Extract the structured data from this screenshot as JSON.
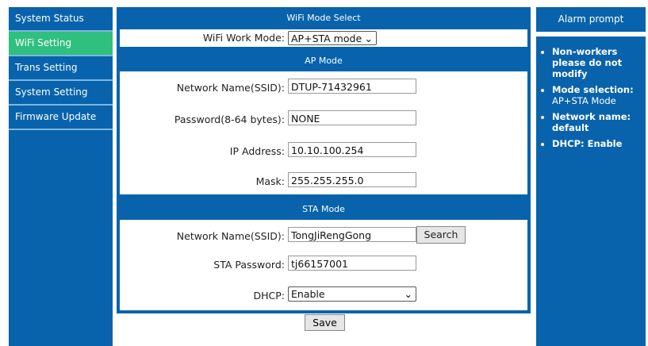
{
  "sidebar": {
    "items": [
      {
        "label": "System Status"
      },
      {
        "label": "WiFi Setting"
      },
      {
        "label": "Trans Setting"
      },
      {
        "label": "System Setting"
      },
      {
        "label": "Firmware Update"
      }
    ]
  },
  "main": {
    "mode_header": "WiFi Mode Select",
    "mode_label": "WiFi Work Mode:",
    "mode_value": "AP+STA mode",
    "ap_header": "AP Mode",
    "ap": {
      "ssid_label": "Network Name(SSID):",
      "ssid": "DTUP-71432961",
      "pwd_label": "Password(8-64 bytes):",
      "pwd": "NONE",
      "ip_label": "IP Address:",
      "ip": "10.10.100.254",
      "mask_label": "Mask:",
      "mask": "255.255.255.0"
    },
    "sta_header": "STA Mode",
    "sta": {
      "ssid_label": "Network Name(SSID):",
      "ssid": "TongJiRengGong",
      "search": "Search",
      "pwd_label": "STA Password:",
      "pwd": "tj66157001",
      "dhcp_label": "DHCP:",
      "dhcp": "Enable"
    },
    "save": "Save"
  },
  "alarm": {
    "title": "Alarm prompt",
    "items": [
      {
        "bold": "Non-workers please do not modify",
        "normal": ""
      },
      {
        "bold": "Mode selection:",
        "normal": "AP+STA Mode"
      },
      {
        "bold": "Network name: default",
        "normal": ""
      },
      {
        "bold": "DHCP: Enable",
        "normal": ""
      }
    ]
  }
}
